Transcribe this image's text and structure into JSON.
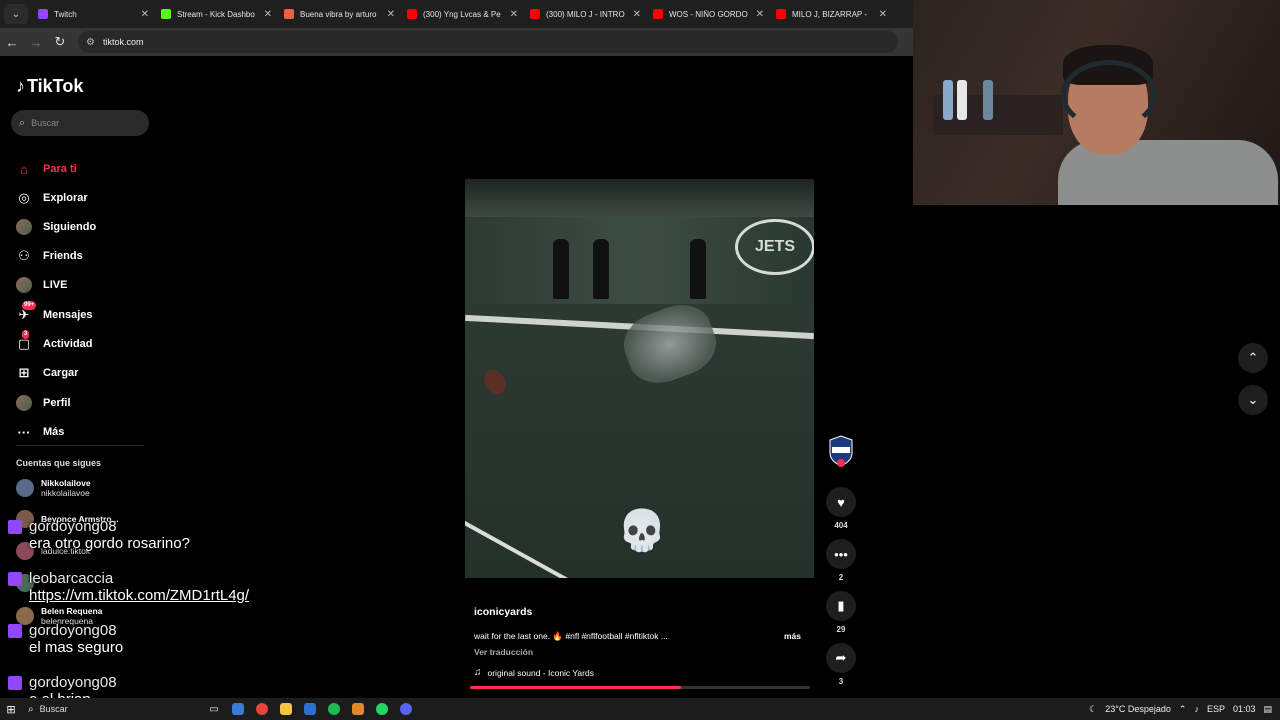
{
  "browser": {
    "tabs": [
      {
        "title": "Twitch",
        "favicon_color": "#9146ff",
        "active": false
      },
      {
        "title": "Stream - Kick Dashbo",
        "favicon_color": "#53fc18",
        "active": false
      },
      {
        "title": "Buena vibra by arturo",
        "favicon_color": "#e8643a",
        "active": false
      },
      {
        "title": "(300) Yng Lvcas & Pe",
        "favicon_color": "#ff0000",
        "active": false
      },
      {
        "title": "(300) MILO J - INTRO",
        "favicon_color": "#ff0000",
        "active": false
      },
      {
        "title": "WOS - NIÑO GORDO",
        "favicon_color": "#ff0000",
        "active": false
      },
      {
        "title": "MILO J, BIZARRAP - ",
        "favicon_color": "#ff0000",
        "active": false
      }
    ],
    "url": "tiktok.com"
  },
  "tiktok": {
    "logo_text": "TikTok",
    "search_placeholder": "Buscar",
    "nav": [
      {
        "label": "Para ti",
        "icon": "home-icon",
        "glyph": "⌂",
        "color": "#fe2c55"
      },
      {
        "label": "Explorar",
        "icon": "compass-icon",
        "glyph": "◎",
        "color": "#ffffff"
      },
      {
        "label": "Siguiendo",
        "icon": "following-avatar-icon",
        "glyph": "",
        "color": "#ffffff"
      },
      {
        "label": "Friends",
        "icon": "friends-icon",
        "glyph": "⚇",
        "color": "#ffffff"
      },
      {
        "label": "LIVE",
        "icon": "live-avatar-icon",
        "glyph": "",
        "color": "#ffffff"
      },
      {
        "label": "Mensajes",
        "icon": "messages-icon",
        "glyph": "✈",
        "color": "#ffffff",
        "badge": "99+"
      },
      {
        "label": "Actividad",
        "icon": "activity-icon",
        "glyph": "▢",
        "color": "#ffffff",
        "badge": "3"
      },
      {
        "label": "Cargar",
        "icon": "upload-icon",
        "glyph": "⊞",
        "color": "#ffffff"
      },
      {
        "label": "Perfil",
        "icon": "profile-avatar-icon",
        "glyph": "",
        "color": "#ffffff"
      },
      {
        "label": "Más",
        "icon": "more-icon",
        "glyph": "···",
        "color": "#ffffff"
      }
    ],
    "following_title": "Cuentas que sigues",
    "following": [
      {
        "name": "Nikkolailove",
        "handle": "nikkolailavoe"
      },
      {
        "name": "Beyonce Armstro...",
        "handle": ""
      },
      {
        "name": "",
        "handle": "ladulce.tiktok"
      },
      {
        "name": "",
        "handle": ""
      },
      {
        "name": "Belen Requena",
        "handle": "belenrequena"
      }
    ],
    "video": {
      "creator": "iconicyards",
      "description": "wait for the last one. 🔥 #nfl #nflfootball #nfltiktok ...",
      "more": "más",
      "translate": "Ver traducción",
      "sound": "original sound - Iconic Yards",
      "overlay_emoji": "💀",
      "field_logo": "JETS",
      "progress": 0.62,
      "likes": "404",
      "comments": "2",
      "saves": "29",
      "shares": "3"
    }
  },
  "chat": [
    {
      "user": "gordoyong08",
      "message": "era otro gordo rosarino?",
      "link": false
    },
    {
      "user": "leobarcaccia",
      "message": "https://vm.tiktok.com/ZMD1rtL4g/",
      "link": true
    },
    {
      "user": "gordoyong08",
      "message": "el mas seguro",
      "link": false
    },
    {
      "user": "gordoyong08",
      "message": "o el brian",
      "link": false
    }
  ],
  "taskbar": {
    "search_label": "Buscar",
    "weather": "23°C  Despejado",
    "lang": "ESP",
    "time": "01:03"
  }
}
